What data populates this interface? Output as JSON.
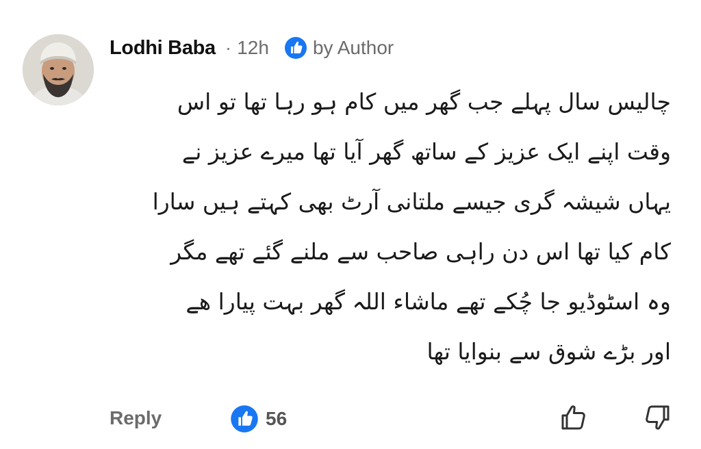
{
  "comment": {
    "author_name": "Lodhi Baba",
    "separator": "·",
    "time_ago": "12h",
    "liked_by_label": "by Author",
    "body_lines": [
      "چالیس سال پہلے جب گھر میں کام ہو رہا تھا تو اس",
      "وقت اپنے ایک عزیز کے ساتھ گھر آیا تھا میرے عزیز نے",
      "یہاں شیشہ گری جیسے ملتانی آرٹ بھی کہتے ہیں سارا",
      "کام کیا تھا اس دن راہی صاحب سے ملنے گئے تھے مگر",
      "وہ اسٹوڈیو جا چُکے تھے ماشاء اللہ گھر بہت پیارا ھے",
      "اور بڑے شوق سے بنوایا تھا"
    ]
  },
  "actions": {
    "reply_label": "Reply",
    "like_count": "56"
  },
  "icons": {
    "liked_badge": "like-badge-icon",
    "avatar": "avatar-image",
    "like_summary": "like-count-icon",
    "thumb_up": "thumbs-up-icon",
    "thumb_down": "thumbs-down-icon"
  },
  "colors": {
    "like_blue": "#1877F2",
    "meta_gray": "#6b6b6b",
    "text_dark": "#1a1a1a"
  }
}
